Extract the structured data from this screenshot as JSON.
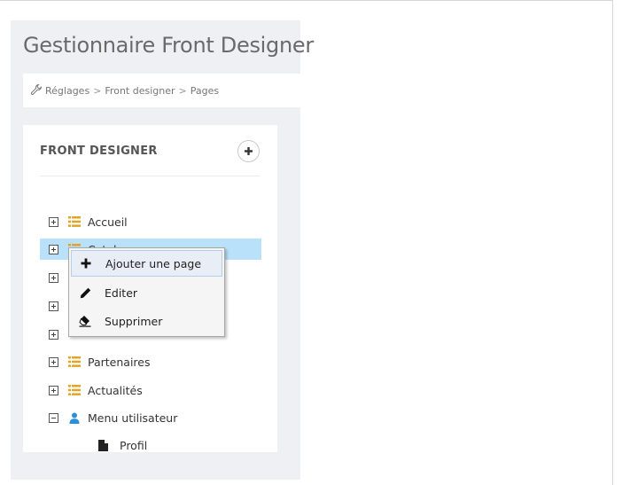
{
  "header": {
    "title": "Gestionnaire Front Designer"
  },
  "breadcrumb": {
    "icon": "wrench-icon",
    "items": [
      "Réglages",
      "Front designer",
      "Pages"
    ],
    "separator": ">"
  },
  "panel": {
    "title": "FRONT DESIGNER",
    "add_button_icon": "plus-icon"
  },
  "tree": {
    "items": [
      {
        "label": "Accueil",
        "expanded": false,
        "icon": "list-icon"
      },
      {
        "label": "Catalogue",
        "expanded": false,
        "icon": "list-icon",
        "selected": true
      },
      {
        "label": "",
        "expanded": false,
        "icon": "list-icon"
      },
      {
        "label": "",
        "expanded": false,
        "icon": "list-icon"
      },
      {
        "label": "",
        "expanded": false,
        "icon": "list-icon"
      },
      {
        "label": "Partenaires",
        "expanded": false,
        "icon": "list-icon"
      },
      {
        "label": "Actualités",
        "expanded": false,
        "icon": "list-icon"
      },
      {
        "label": "Menu utilisateur",
        "expanded": true,
        "icon": "user-icon"
      },
      {
        "label": "Profil",
        "icon": "file-icon",
        "child": true
      }
    ]
  },
  "context_menu": {
    "items": [
      {
        "label": "Ajouter une page",
        "icon": "plus-icon",
        "hover": true
      },
      {
        "label": "Editer",
        "icon": "pencil-icon"
      },
      {
        "label": "Supprimer",
        "icon": "eraser-icon"
      }
    ]
  },
  "colors": {
    "selected_row": "#b9e2fa",
    "list_icon": "#e0a526",
    "user_icon": "#2d8fd5"
  }
}
